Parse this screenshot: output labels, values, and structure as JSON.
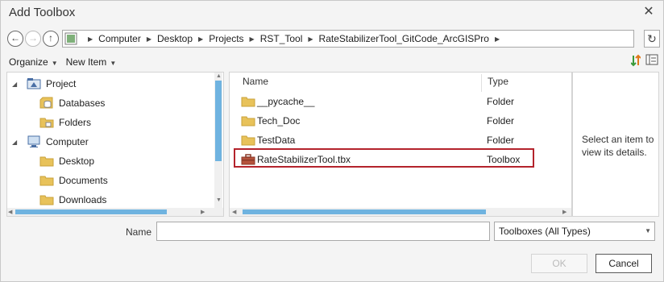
{
  "window": {
    "title": "Add Toolbox",
    "close_glyph": "✕"
  },
  "nav": {
    "back_glyph": "←",
    "forward_glyph": "→",
    "up_glyph": "↑",
    "refresh_glyph": "↻",
    "breadcrumb": [
      "Computer",
      "Desktop",
      "Projects",
      "RST_Tool",
      "RateStabilizerTool_GitCode_ArcGISPro"
    ]
  },
  "toolbar": {
    "organize": "Organize",
    "new_item": "New Item"
  },
  "tree": {
    "items": [
      {
        "label": "Project",
        "icon": "project-icon",
        "expander": "◢"
      },
      {
        "label": "Databases",
        "icon": "database-icon"
      },
      {
        "label": "Folders",
        "icon": "folder-icon"
      },
      {
        "label": "Computer",
        "icon": "computer-icon",
        "expander": "◢"
      },
      {
        "label": "Desktop",
        "icon": "folder-icon"
      },
      {
        "label": "Documents",
        "icon": "folder-icon"
      },
      {
        "label": "Downloads",
        "icon": "folder-icon"
      }
    ]
  },
  "list": {
    "columns": {
      "name": "Name",
      "type": "Type"
    },
    "rows": [
      {
        "name": "__pycache__",
        "type": "Folder",
        "icon": "folder-icon"
      },
      {
        "name": "Tech_Doc",
        "type": "Folder",
        "icon": "folder-icon"
      },
      {
        "name": "TestData",
        "type": "Folder",
        "icon": "folder-icon"
      },
      {
        "name": "RateStabilizerTool.tbx",
        "type": "Toolbox",
        "icon": "toolbox-icon",
        "highlighted": true
      }
    ]
  },
  "details": {
    "text": "Select an item to view its details."
  },
  "form": {
    "name_label": "Name",
    "name_value": "",
    "type_filter": "Toolboxes (All Types)"
  },
  "buttons": {
    "ok": "OK",
    "cancel": "Cancel"
  },
  "colors": {
    "highlight_border": "#b4232c",
    "scroll_thumb": "#6fb3e0",
    "folder": "#e8c25a",
    "toolbox": "#b5533c"
  }
}
